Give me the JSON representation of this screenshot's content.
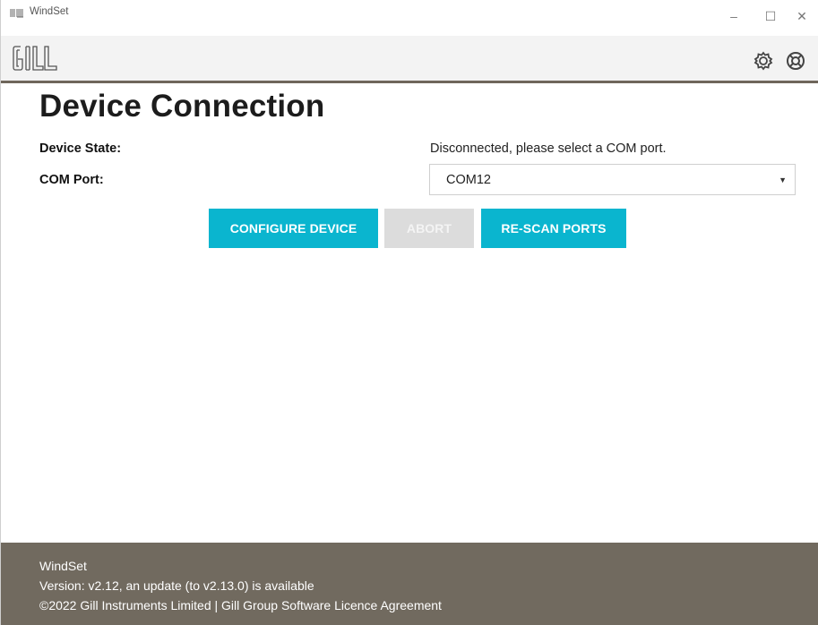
{
  "window": {
    "title": "WindSet",
    "minimize_glyph": "–",
    "maximize_glyph": "☐",
    "close_glyph": "✕"
  },
  "header": {
    "logo_text": "GILL",
    "settings_icon": "gear-icon",
    "help_icon": "lifebuoy-icon"
  },
  "main": {
    "title": "Device Connection",
    "device_state_label": "Device State:",
    "device_state_value": "Disconnected, please select a COM port.",
    "com_port_label": "COM Port:",
    "com_port_value": "COM12",
    "buttons": {
      "configure": "CONFIGURE DEVICE",
      "abort": "ABORT",
      "rescan": "RE-SCAN PORTS"
    }
  },
  "footer": {
    "app_name": "WindSet",
    "version": "Version: v2.12, an update (to v2.13.0) is available",
    "copyright": "©2022 Gill Instruments Limited | Gill Group Software Licence Agreement"
  },
  "colors": {
    "accent": "#0ab5cf",
    "footer_bg": "#716a5f",
    "header_rule": "#6f665b",
    "disabled": "#dcdcdc"
  }
}
